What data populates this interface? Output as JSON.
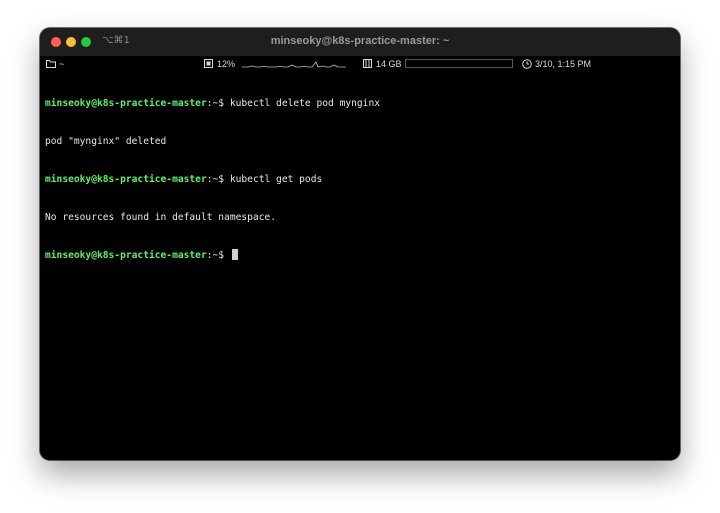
{
  "window": {
    "title": "minseoky@k8s-practice-master: ~",
    "shortcut": "⌥⌘1"
  },
  "statusbar": {
    "cwd": "~",
    "cpu": "12%",
    "memory": "14 GB",
    "memory_used_fraction": 0.0,
    "clock": "3/10, 1:15 PM"
  },
  "terminal": {
    "prompt": "minseoky@k8s-practice-master",
    "prompt_suffix": ":~$",
    "lines": [
      {
        "command": " kubectl delete pod mynginx"
      },
      {
        "output": "pod \"mynginx\" deleted"
      },
      {
        "command": " kubectl get pods"
      },
      {
        "output": "No resources found in default namespace."
      },
      {
        "command": " "
      }
    ]
  },
  "colors": {
    "prompt": "#5ef06b",
    "background": "#000000",
    "text": "#e6e6e6"
  },
  "icons": {
    "folder": "folder-icon",
    "cpu": "cpu-icon",
    "memory": "memory-icon",
    "clock": "clock-icon"
  }
}
